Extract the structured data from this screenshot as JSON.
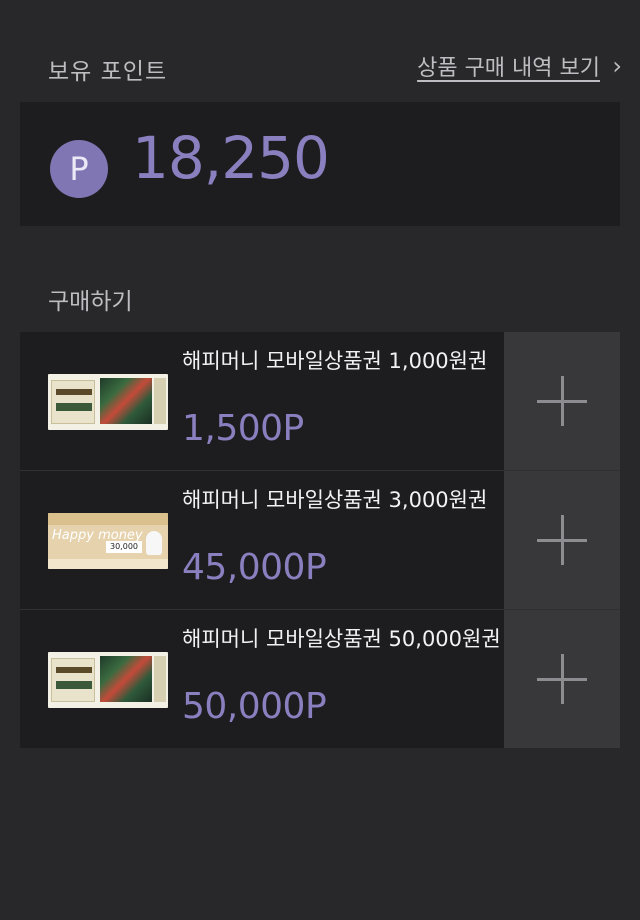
{
  "header": {
    "points_title": "보유 포인트",
    "history_link": "상품 구매 내역 보기",
    "chevron": "›"
  },
  "balance": {
    "badge": "P",
    "value": "18,250"
  },
  "purchase": {
    "section_title": "구매하기",
    "items": [
      {
        "name": "해피머니 모바일상품권 1,000원권",
        "price": "1,500P",
        "thumb": "culture-voucher-image"
      },
      {
        "name": "해피머니 모바일상품권 3,000원권",
        "price": "45,000P",
        "thumb": "happy-money-voucher-image",
        "thumb_text": "Happy money",
        "thumb_amount": "30,000"
      },
      {
        "name": "해피머니 모바일상품권 50,000원권",
        "price": "50,000P",
        "thumb": "culture-voucher-image"
      }
    ]
  },
  "colors": {
    "background": "#28282b",
    "card": "#1d1d1f",
    "accent": "#8a80c0",
    "badge": "#7f76b3",
    "button": "#38383b"
  }
}
